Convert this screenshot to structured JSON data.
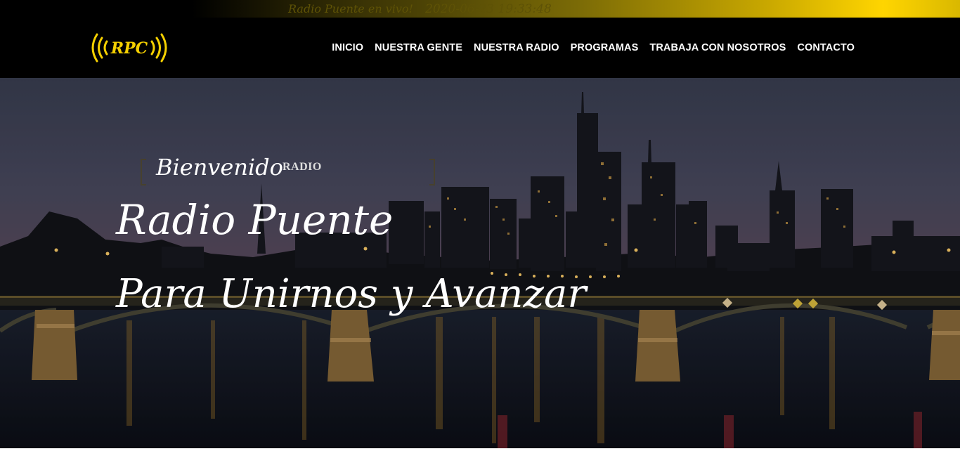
{
  "topbar": {
    "text": "Radio Puente en vivo!",
    "datetime": "2020-06-23 19:33:48"
  },
  "logo": {
    "text": "RPC",
    "color": "#f5d000"
  },
  "nav": [
    {
      "label": "INICIO"
    },
    {
      "label": "NUESTRA GENTE"
    },
    {
      "label": "NUESTRA RADIO"
    },
    {
      "label": "PROGRAMAS"
    },
    {
      "label": "TRABAJA CON NOSOTROS"
    },
    {
      "label": "CONTACTO"
    }
  ],
  "hero": {
    "welcome": "Bienvenido",
    "radio": "RADIO",
    "title_line1": "Radio Puente",
    "title_line2": "Para Unirnos y Avanzar"
  },
  "colors": {
    "accent": "#ffd500",
    "header_bg": "#000000"
  }
}
